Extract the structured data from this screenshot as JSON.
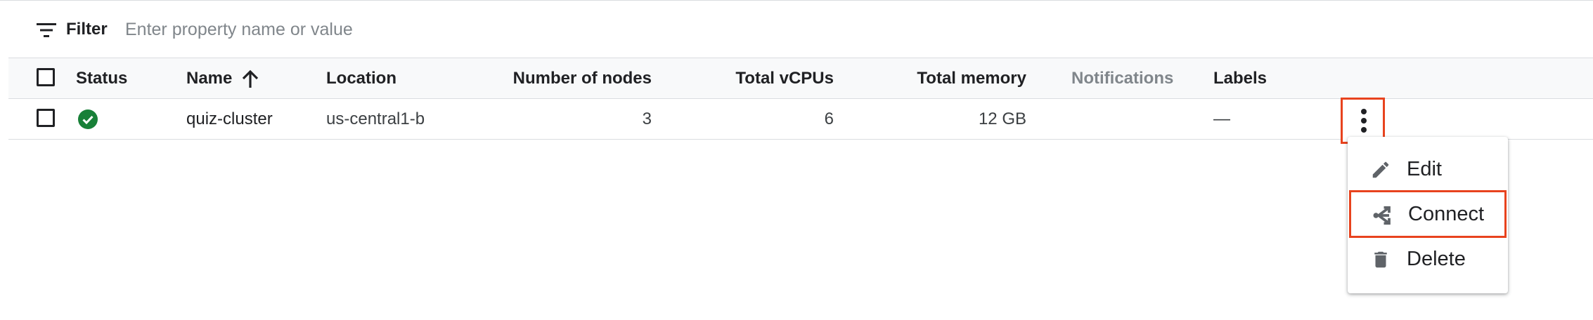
{
  "filter": {
    "label": "Filter",
    "placeholder": "Enter property name or value",
    "value": "",
    "icon": "filter-list-icon"
  },
  "table": {
    "columns": [
      {
        "key": "status",
        "label": "Status"
      },
      {
        "key": "name",
        "label": "Name",
        "sort": "ascending"
      },
      {
        "key": "location",
        "label": "Location"
      },
      {
        "key": "nodes",
        "label": "Number of nodes"
      },
      {
        "key": "vcpus",
        "label": "Total vCPUs"
      },
      {
        "key": "memory",
        "label": "Total memory"
      },
      {
        "key": "notifications",
        "label": "Notifications"
      },
      {
        "key": "labels",
        "label": "Labels"
      }
    ],
    "rows": [
      {
        "status": "check-circle-icon",
        "name": "quiz-cluster",
        "location": "us-central1-b",
        "nodes": "3",
        "vcpus": "6",
        "memory": "12 GB",
        "notifications": "",
        "labels": "—"
      }
    ]
  },
  "row_menu": {
    "items": [
      {
        "label": "Edit",
        "icon": "pencil-icon"
      },
      {
        "label": "Connect",
        "icon": "connect-icon",
        "highlighted": true
      },
      {
        "label": "Delete",
        "icon": "trash-icon"
      }
    ]
  },
  "colors": {
    "highlight": "#e8431e",
    "status_ok": "#188038",
    "text": "#202124",
    "muted": "#80868b",
    "icon": "#5f6368"
  }
}
